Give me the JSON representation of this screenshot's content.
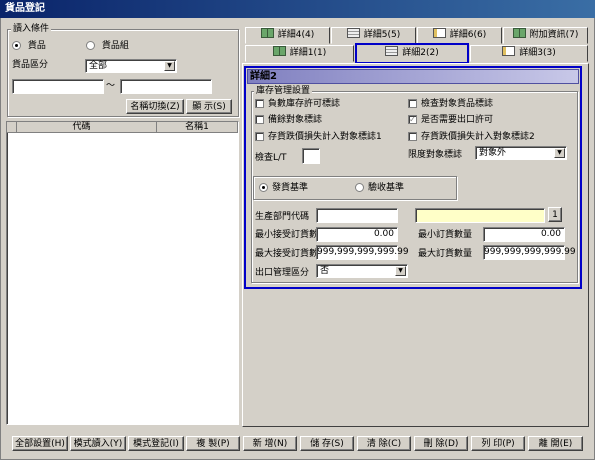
{
  "window": {
    "title": "貨品登記"
  },
  "filter": {
    "group_title": "讀入條件",
    "radio_item": "貨品",
    "radio_group": "貨品組",
    "category_label": "貨品區分",
    "category_value": "全部",
    "range_separator": "～",
    "from_value": "",
    "to_value": "",
    "toggle_name_button": "名稱切換(Z)",
    "show_button": "顯 示(S)"
  },
  "list": {
    "columns": [
      "代碼",
      "名稱1"
    ]
  },
  "tabs": {
    "row1": [
      "詳細4(4)",
      "詳細5(5)",
      "詳細6(6)",
      "附加資訊(7)"
    ],
    "row2": [
      "詳細1(1)",
      "詳細2(2)",
      "詳細3(3)"
    ]
  },
  "detail": {
    "title": "詳細2",
    "group_title": "庫存管理設置",
    "checks": {
      "negative_stock": "負數庫存許可標誌",
      "inspection_item": "檢查對象貨品標誌",
      "reserve_target": "備餘對象標誌",
      "export_permit": "是否需要出口許可",
      "stock_loss1": "存貨跌價損失計入對象標誌1",
      "stock_loss2": "存貨跌價損失計入對象標誌2"
    },
    "inspection_lt_label": "檢查L/T",
    "inspection_lt_value": "",
    "limit_label": "限度對象標誌",
    "limit_value": "對象外",
    "basis": {
      "shipment": "發貨基準",
      "receipt": "驗收基準"
    },
    "dept_label": "生產部門代碼",
    "dept_value": "",
    "dept_name_value": "",
    "dept_button": "1",
    "min_accept_label": "最小接受訂貨數量",
    "min_accept_value": "0.00",
    "min_order_label": "最小訂貨數量",
    "min_order_value": "0.00",
    "max_accept_label": "最大接受訂貨數量",
    "max_accept_value": "999,999,999,999.99",
    "max_order_label": "最大訂貨數量",
    "max_order_value": "999,999,999,999.99",
    "export_mgmt_label": "出口管理區分",
    "export_mgmt_value": "否"
  },
  "footer": {
    "buttons": [
      "全部設置(H)",
      "模式讀入(Y)",
      "模式登記(I)",
      "複 製(P)",
      "新 增(N)",
      "儲 存(S)",
      "清 除(C)",
      "刪 除(D)",
      "列 印(P)",
      "離 開(E)"
    ]
  },
  "colors": {
    "highlight_border": "#0000c8",
    "title_bar": "#0a246a",
    "dept_name_bg": "#ffffc8"
  }
}
